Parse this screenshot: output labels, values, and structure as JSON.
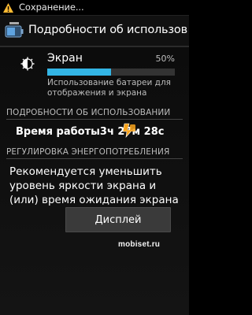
{
  "statusbar": {
    "notification_text": "Сохранение...",
    "notification_icon": "warning-icon"
  },
  "actionbar": {
    "title": "Подробности об использова…",
    "icon": "battery-settings-icon"
  },
  "usage": {
    "label": "Экран",
    "percent_text": "50%",
    "percent": 0.5,
    "description": "Использование батареи для отображения и экрана",
    "icon": "brightness-icon",
    "accent_color": "#33b5e5"
  },
  "details": {
    "header": "ПОДРОБНОСТИ ОБ ИСПОЛЬЗОВАНИИ",
    "worktime": "Время работы3ч 27м 28с"
  },
  "power": {
    "header": "РЕГУЛИРОВКА ЭНЕРГОПОТРЕБЛЕНИЯ",
    "recommendation": "Рекомендуется уменьшить уровень яркости экрана и (или) время ожидания экрана",
    "button_label": "Дисплей"
  },
  "watermark": "mobiset.ru"
}
